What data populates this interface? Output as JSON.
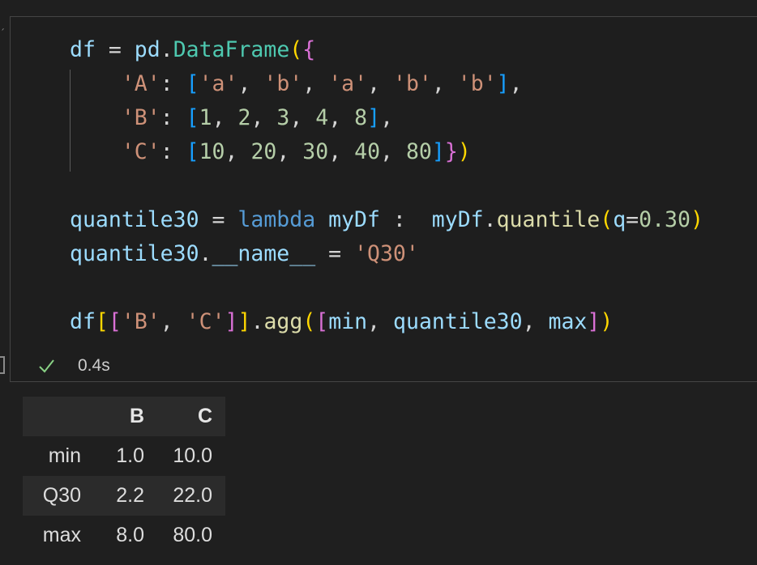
{
  "cell": {
    "code_lines": [
      [
        [
          "var",
          "df"
        ],
        [
          "op",
          " = "
        ],
        [
          "var",
          "pd"
        ],
        [
          "op",
          "."
        ],
        [
          "fn",
          "DataFrame"
        ],
        [
          "b1",
          "("
        ],
        [
          "b2",
          "{"
        ]
      ],
      [
        [
          "op",
          "    "
        ],
        [
          "str",
          "'A'"
        ],
        [
          "op",
          ": "
        ],
        [
          "b3",
          "["
        ],
        [
          "str",
          "'a'"
        ],
        [
          "op",
          ", "
        ],
        [
          "str",
          "'b'"
        ],
        [
          "op",
          ", "
        ],
        [
          "str",
          "'a'"
        ],
        [
          "op",
          ", "
        ],
        [
          "str",
          "'b'"
        ],
        [
          "op",
          ", "
        ],
        [
          "str",
          "'b'"
        ],
        [
          "b3",
          "]"
        ],
        [
          "op",
          ","
        ]
      ],
      [
        [
          "op",
          "    "
        ],
        [
          "str",
          "'B'"
        ],
        [
          "op",
          ": "
        ],
        [
          "b3",
          "["
        ],
        [
          "num",
          "1"
        ],
        [
          "op",
          ", "
        ],
        [
          "num",
          "2"
        ],
        [
          "op",
          ", "
        ],
        [
          "num",
          "3"
        ],
        [
          "op",
          ", "
        ],
        [
          "num",
          "4"
        ],
        [
          "op",
          ", "
        ],
        [
          "num",
          "8"
        ],
        [
          "b3",
          "]"
        ],
        [
          "op",
          ","
        ]
      ],
      [
        [
          "op",
          "    "
        ],
        [
          "str",
          "'C'"
        ],
        [
          "op",
          ": "
        ],
        [
          "b3",
          "["
        ],
        [
          "num",
          "10"
        ],
        [
          "op",
          ", "
        ],
        [
          "num",
          "20"
        ],
        [
          "op",
          ", "
        ],
        [
          "num",
          "30"
        ],
        [
          "op",
          ", "
        ],
        [
          "num",
          "40"
        ],
        [
          "op",
          ", "
        ],
        [
          "num",
          "80"
        ],
        [
          "b3",
          "]"
        ],
        [
          "b2",
          "}"
        ],
        [
          "b1",
          ")"
        ]
      ],
      [],
      [
        [
          "var",
          "quantile30"
        ],
        [
          "op",
          " = "
        ],
        [
          "kw",
          "lambda"
        ],
        [
          "op",
          " "
        ],
        [
          "var",
          "myDf"
        ],
        [
          "op",
          " :  "
        ],
        [
          "var",
          "myDf"
        ],
        [
          "op",
          "."
        ],
        [
          "call",
          "quantile"
        ],
        [
          "b1",
          "("
        ],
        [
          "var",
          "q"
        ],
        [
          "op",
          "="
        ],
        [
          "num",
          "0.30"
        ],
        [
          "b1",
          ")"
        ]
      ],
      [
        [
          "var",
          "quantile30"
        ],
        [
          "op",
          "."
        ],
        [
          "var",
          "__name__"
        ],
        [
          "op",
          " = "
        ],
        [
          "str",
          "'Q30'"
        ]
      ],
      [],
      [
        [
          "var",
          "df"
        ],
        [
          "b1",
          "["
        ],
        [
          "b2",
          "["
        ],
        [
          "str",
          "'B'"
        ],
        [
          "op",
          ", "
        ],
        [
          "str",
          "'C'"
        ],
        [
          "b2",
          "]"
        ],
        [
          "b1",
          "]"
        ],
        [
          "op",
          "."
        ],
        [
          "call",
          "agg"
        ],
        [
          "b1",
          "("
        ],
        [
          "b2",
          "["
        ],
        [
          "var",
          "min"
        ],
        [
          "op",
          ", "
        ],
        [
          "var",
          "quantile30"
        ],
        [
          "op",
          ", "
        ],
        [
          "var",
          "max"
        ],
        [
          "b2",
          "]"
        ],
        [
          "b1",
          ")"
        ]
      ]
    ],
    "status": {
      "icon": "check-icon",
      "exec_time": "0.4s",
      "check_color": "#89d185"
    }
  },
  "output_table": {
    "columns": [
      "",
      "B",
      "C"
    ],
    "rows": [
      [
        "min",
        "1.0",
        "10.0"
      ],
      [
        "Q30",
        "2.2",
        "22.0"
      ],
      [
        "max",
        "8.0",
        "80.0"
      ]
    ]
  }
}
